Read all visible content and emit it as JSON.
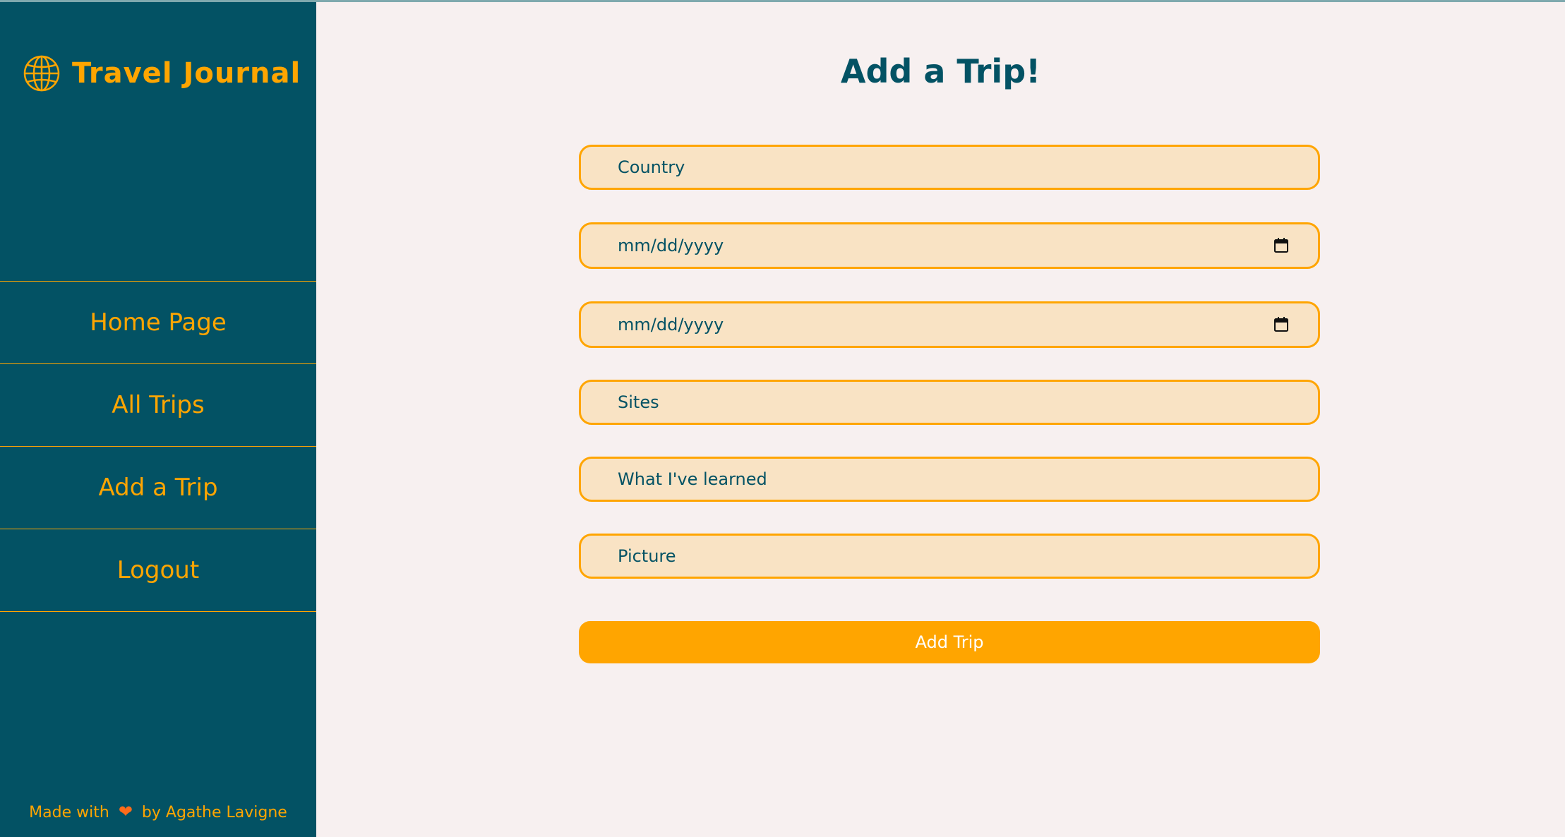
{
  "app": {
    "title": "Travel Journal"
  },
  "sidebar": {
    "nav": [
      {
        "label": "Home Page"
      },
      {
        "label": "All Trips"
      },
      {
        "label": "Add a Trip"
      },
      {
        "label": "Logout"
      }
    ],
    "footer": {
      "prefix": "Made with",
      "heart": "❤",
      "suffix": "by Agathe Lavigne"
    }
  },
  "main": {
    "title": "Add a Trip!",
    "form": {
      "country_placeholder": "Country",
      "start_date_placeholder": "mm/dd/yyyy",
      "end_date_placeholder": "mm/dd/yyyy",
      "sites_placeholder": "Sites",
      "learned_placeholder": "What I've learned",
      "picture_placeholder": "Picture",
      "submit_label": "Add Trip"
    }
  },
  "icons": {
    "brand": "globe-icon",
    "date": "calendar-icon",
    "footer": "heart-icon"
  },
  "colors": {
    "sidebar": "#035264",
    "accent": "#ffa500",
    "field_bg": "#f9e3c4",
    "page_bg": "#f7f0f0",
    "heart": "#ff6b1a"
  }
}
